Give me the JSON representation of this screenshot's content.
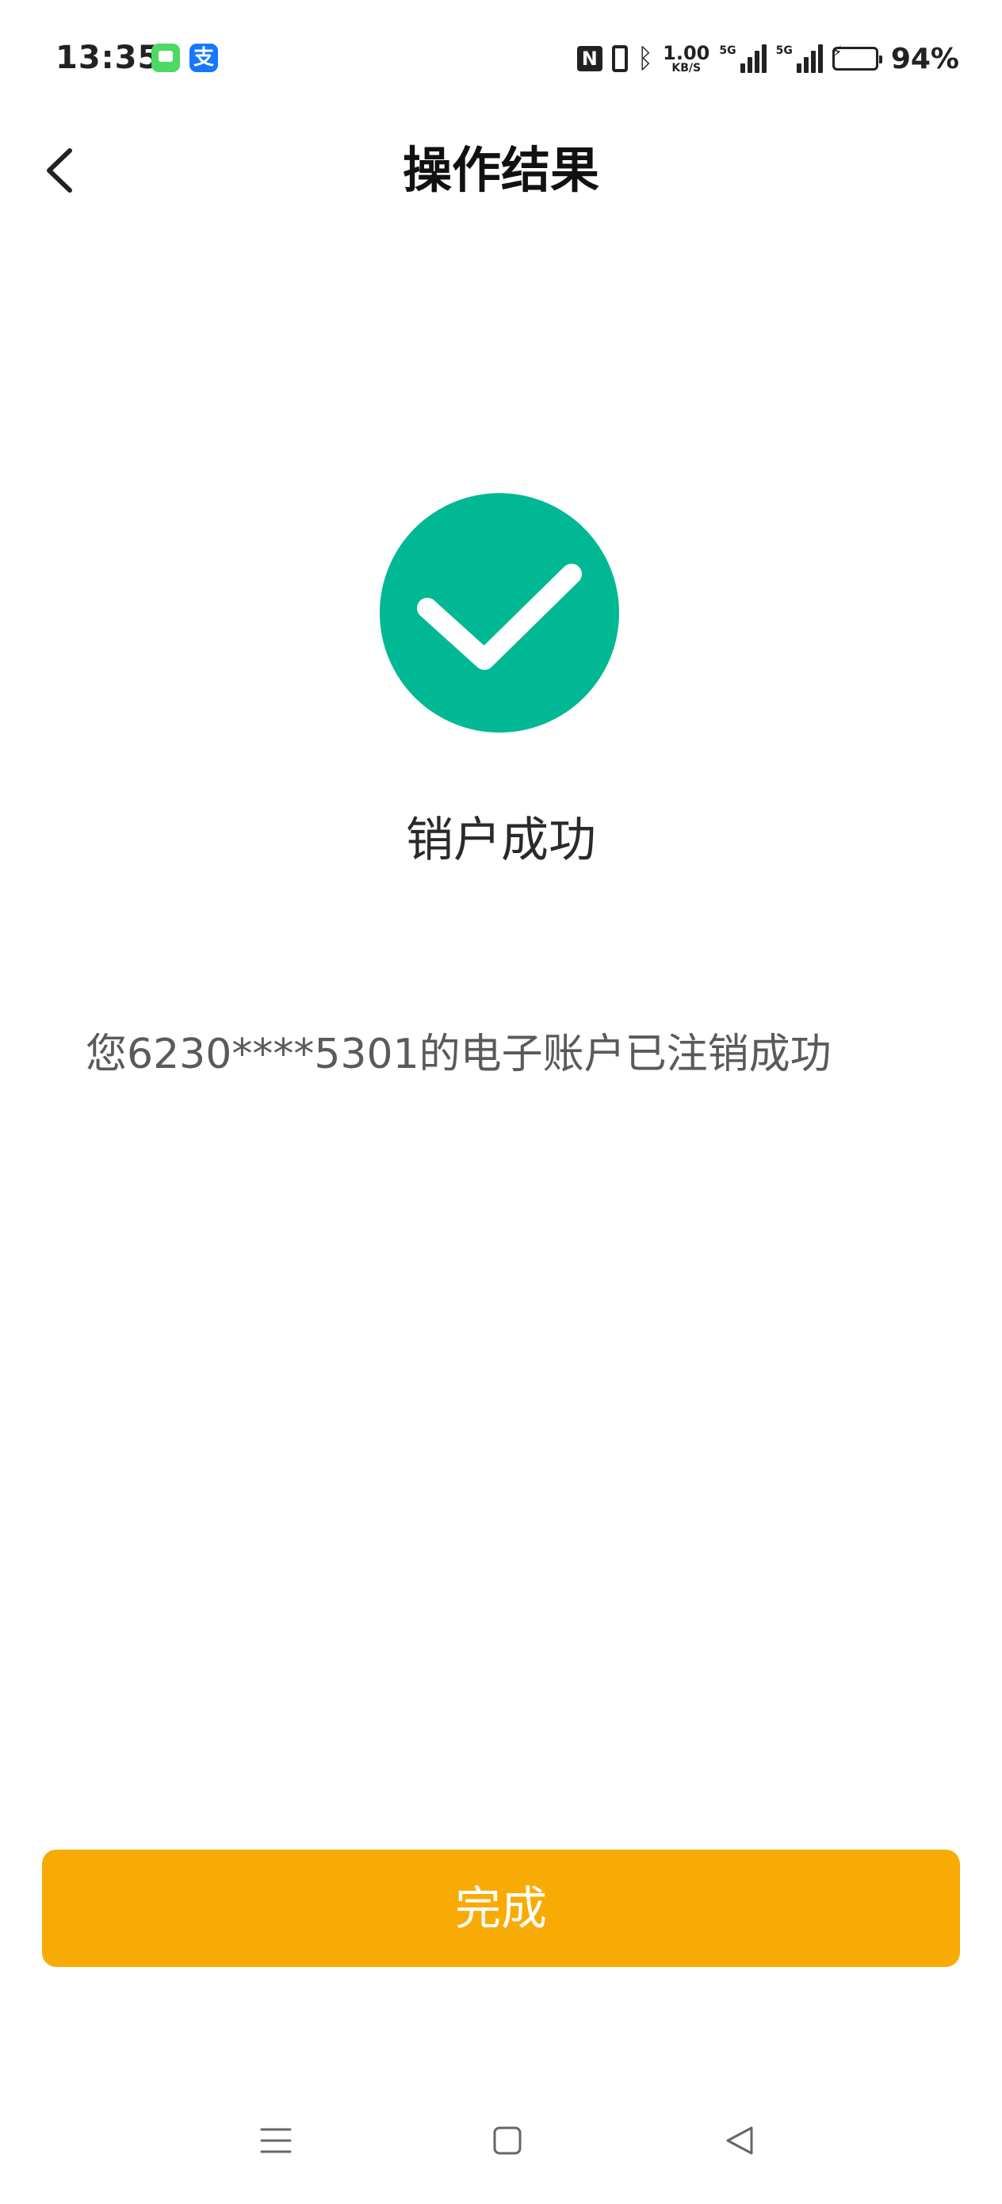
{
  "status_bar": {
    "time": "13:35",
    "notif_pay_glyph": "支",
    "nfc_glyph": "N",
    "network_speed_value": "1.00",
    "network_speed_unit": "KB/S",
    "signal1_tag": "5G",
    "signal2_tag": "5G",
    "battery_percent": "94%",
    "battery_level": 0.94,
    "icons": [
      "message-app-icon",
      "alipay-app-icon",
      "nfc-icon",
      "vibrate-icon",
      "bluetooth-icon",
      "signal-icon",
      "battery-icon"
    ]
  },
  "header": {
    "title": "操作结果",
    "back_icon": "chevron-left-icon"
  },
  "result": {
    "icon": "check-circle-icon",
    "icon_color": "#00b894",
    "title": "销户成功",
    "message": "您6230****5301的电子账户已注销成功"
  },
  "actions": {
    "done_label": "完成",
    "done_color": "#f9ab05"
  },
  "nav_bar": {
    "icons": [
      "menu-icon",
      "home-icon",
      "back-triangle-icon"
    ]
  }
}
